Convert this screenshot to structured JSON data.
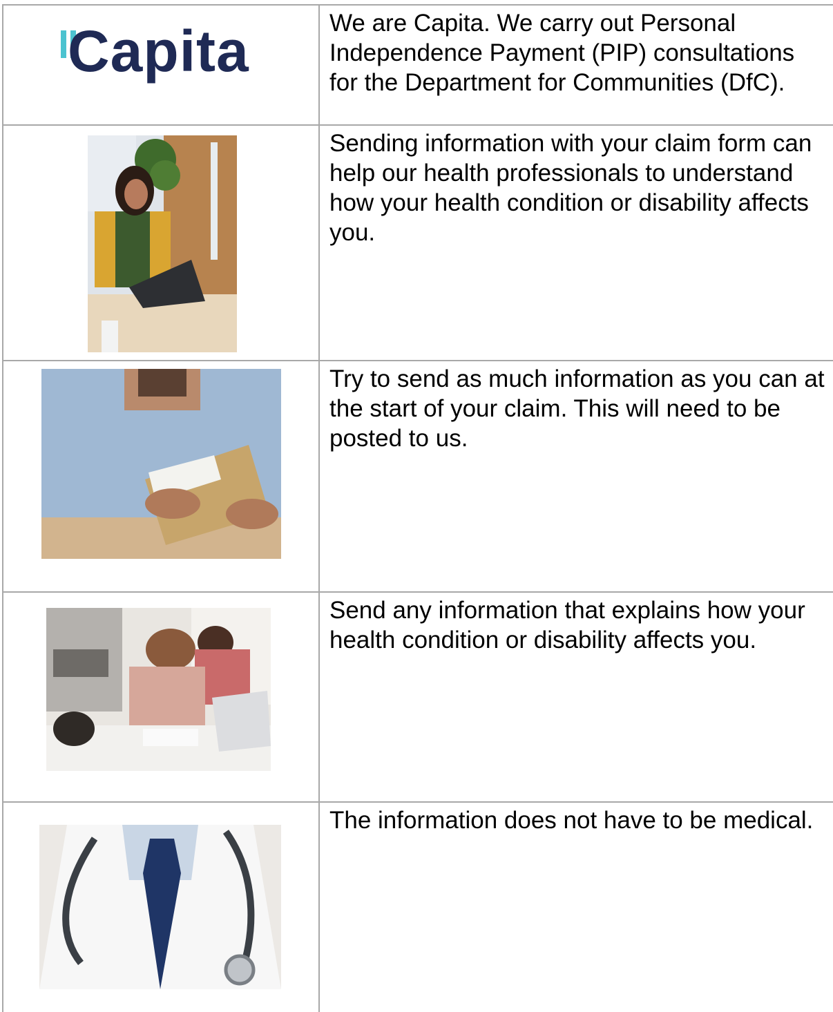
{
  "logo": {
    "text": "Capita"
  },
  "rows": [
    {
      "text": "We are Capita. We carry out Personal Independence Payment (PIP) consultations for the Department for Communities (DfC)."
    },
    {
      "text": "Sending information with your claim form can help our health professionals to understand how your health condition or disability affects you."
    },
    {
      "text": "Try to send as much information as you can at the start of your claim. This will need to be posted to us."
    },
    {
      "text": "Send any information that explains how your health condition or disability affects you."
    },
    {
      "text": "The information does not have to be medical."
    }
  ]
}
